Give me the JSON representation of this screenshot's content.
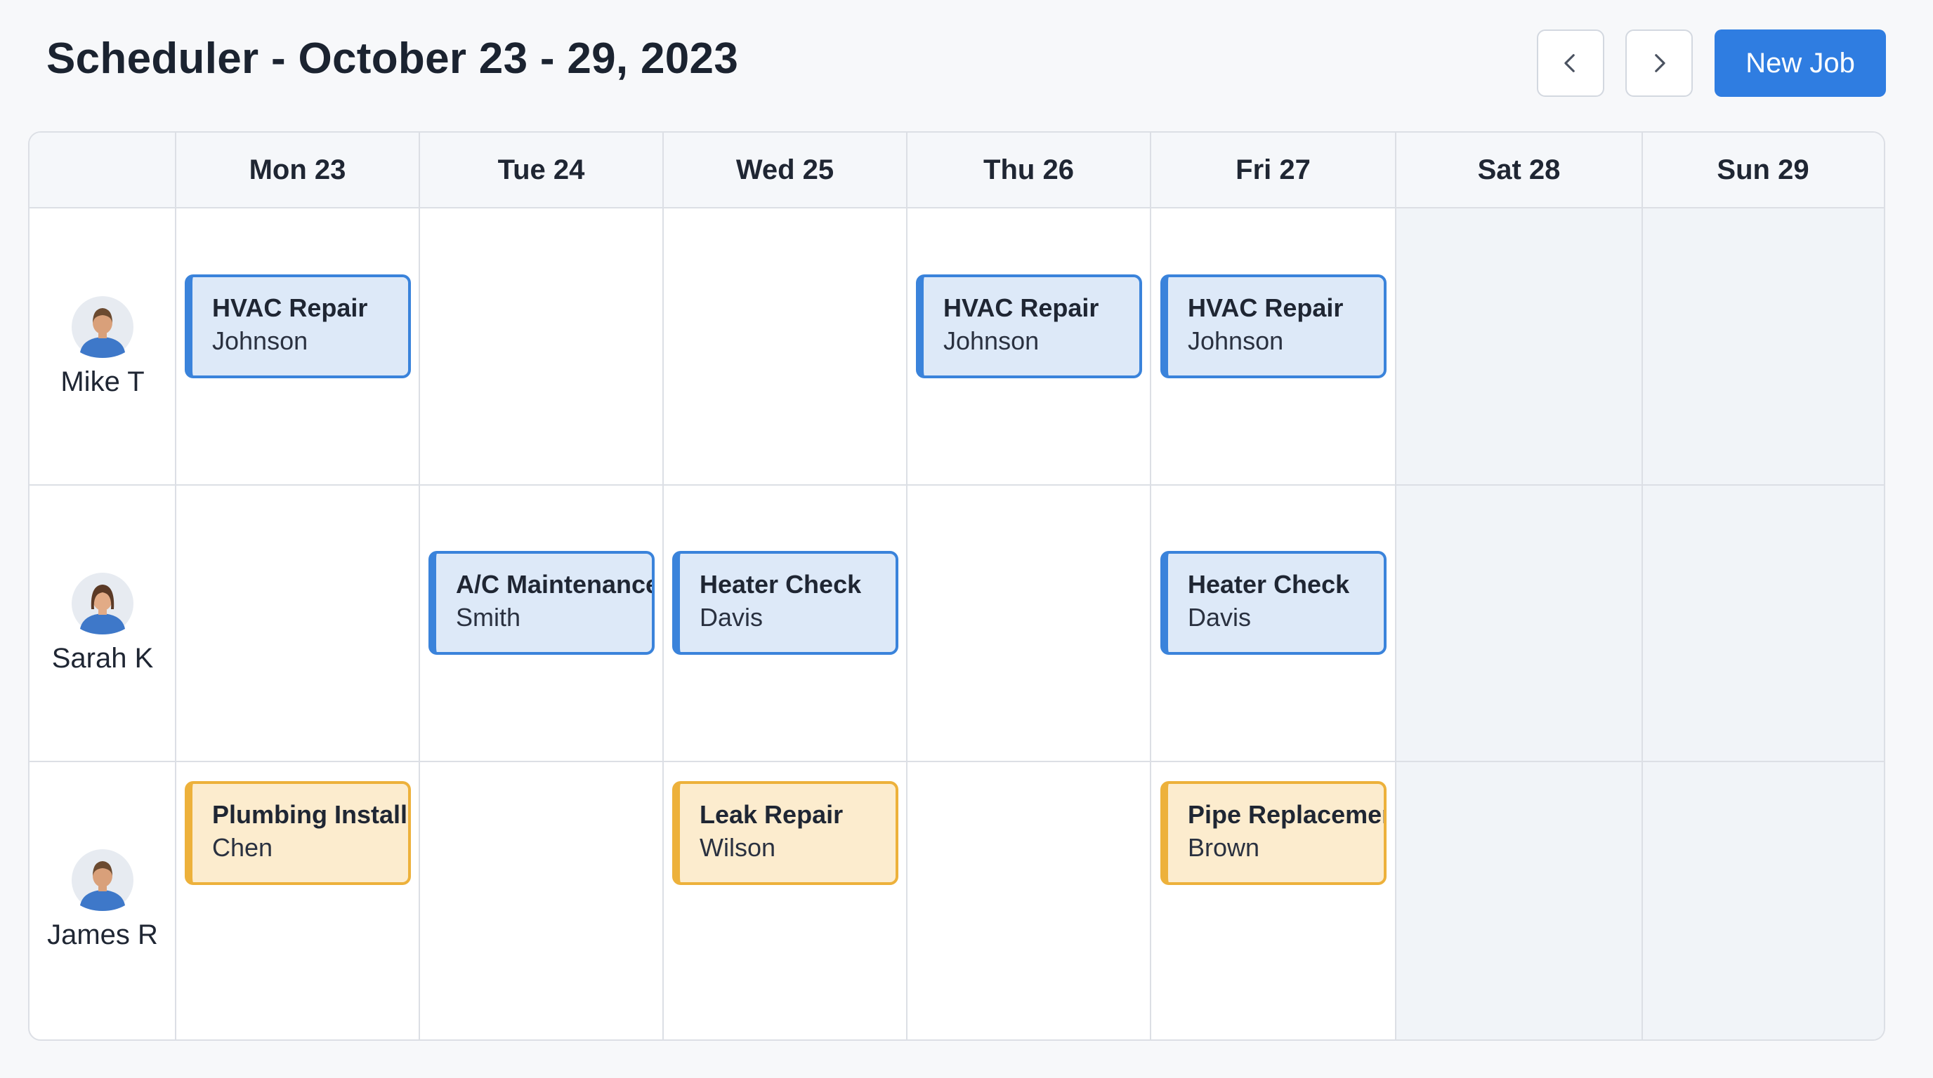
{
  "header": {
    "title": "Scheduler - October 23 - 29, 2023",
    "new_job_label": "New Job",
    "prev_icon": "chevron-left-icon",
    "next_icon": "chevron-right-icon"
  },
  "colors": {
    "accent": "#2f7de1",
    "hvac_border": "#3a83db",
    "hvac_fill": "#dde9f8",
    "plumbing_border": "#edb13b",
    "plumbing_fill": "#fcecce",
    "weekend_fill": "#f1f4f8"
  },
  "days": [
    "Mon 23",
    "Tue 24",
    "Wed 25",
    "Thu 26",
    "Fri 27",
    "Sat 28",
    "Sun 29"
  ],
  "technicians": [
    {
      "name": "Mike T",
      "avatar": "male-avatar-icon",
      "jobs": [
        {
          "day": "Mon 23",
          "title": "HVAC Repair",
          "client": "Johnson",
          "category": "hvac"
        },
        {
          "day": "Thu 26",
          "title": "HVAC Repair",
          "client": "Johnson",
          "category": "hvac"
        },
        {
          "day": "Fri 27",
          "title": "HVAC Repair",
          "client": "Johnson",
          "category": "hvac"
        }
      ]
    },
    {
      "name": "Sarah K",
      "avatar": "female-avatar-icon",
      "jobs": [
        {
          "day": "Tue 24",
          "title": "A/C Maintenance",
          "client": "Smith",
          "category": "hvac"
        },
        {
          "day": "Wed 25",
          "title": "Heater Check",
          "client": "Davis",
          "category": "hvac"
        },
        {
          "day": "Fri 27",
          "title": "Heater Check",
          "client": "Davis",
          "category": "hvac"
        }
      ]
    },
    {
      "name": "James R",
      "avatar": "male-avatar-icon",
      "jobs": [
        {
          "day": "Mon 23",
          "title": "Plumbing Install",
          "client": "Chen",
          "category": "plumbing"
        },
        {
          "day": "Wed 25",
          "title": "Leak Repair",
          "client": "Wilson",
          "category": "plumbing"
        },
        {
          "day": "Fri 27",
          "title": "Pipe Replacement",
          "client": "Brown",
          "category": "plumbing"
        }
      ]
    }
  ]
}
